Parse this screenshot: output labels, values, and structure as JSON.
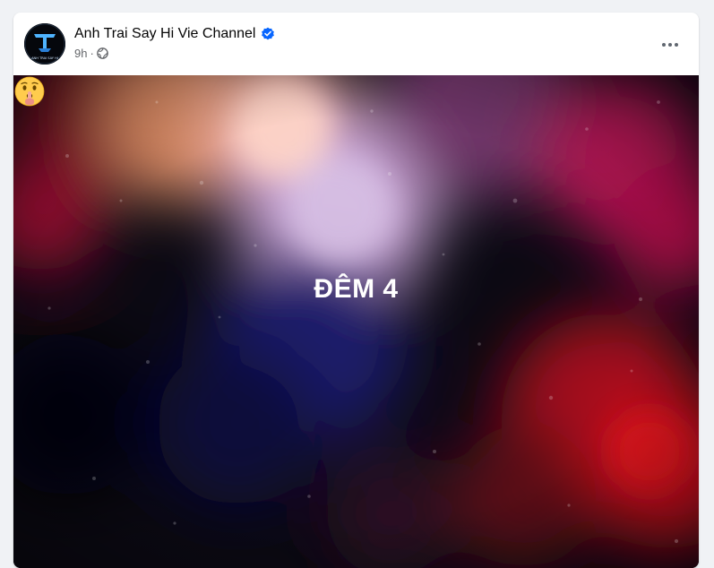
{
  "post": {
    "page_name": "Anh Trai Say Hi Vie Channel",
    "verified": true,
    "time": "9h",
    "separator": "·",
    "audience_icon": "globe-icon",
    "more_icon": "more-options-icon",
    "avatar_text": "ANH TRAI SAY HI",
    "body_text": "ĐÊM 4",
    "body_emoji": "shushing-face-emoji"
  },
  "colors": {
    "verified_blue": "#0866ff",
    "meta_gray": "#65676b",
    "page_bg": "#f0f2f5"
  }
}
